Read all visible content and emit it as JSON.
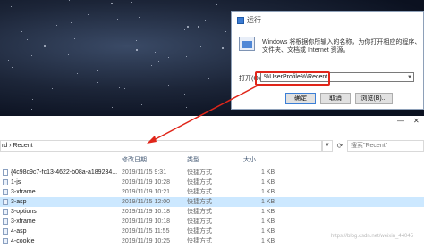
{
  "run_dialog": {
    "title": "运行",
    "description_line1": "Windows 将根据你所输入的名称，为你打开相应的程序、",
    "description_line2": "文件夹、文档或 Internet 资源。",
    "open_label": "打开(O):",
    "input_value": "%UserProfile%\\Recent",
    "buttons": {
      "ok": "确定",
      "cancel": "取消",
      "browse": "浏览(B)..."
    }
  },
  "explorer": {
    "address": "rd › Recent",
    "search_placeholder": "搜索\"Recent\"",
    "columns": {
      "name": "",
      "date": "修改日期",
      "type": "类型",
      "size": "大小"
    },
    "rows": [
      {
        "name": "{4c98c9c7-fc13-4622-b08a-a189234...",
        "date": "2019/11/15 9:31",
        "type": "快捷方式",
        "size": "1 KB"
      },
      {
        "name": "1-js",
        "date": "2019/11/19 10:28",
        "type": "快捷方式",
        "size": "1 KB"
      },
      {
        "name": "3-xframe",
        "date": "2019/11/19 10:21",
        "type": "快捷方式",
        "size": "1 KB"
      },
      {
        "name": "3-asp",
        "date": "2019/11/15 12:00",
        "type": "快捷方式",
        "size": "1 KB"
      },
      {
        "name": "3-options",
        "date": "2019/11/19 10:18",
        "type": "快捷方式",
        "size": "1 KB"
      },
      {
        "name": "3-xframe",
        "date": "2019/11/19 10:18",
        "type": "快捷方式",
        "size": "1 KB"
      },
      {
        "name": "4-asp",
        "date": "2019/11/15 11:55",
        "type": "快捷方式",
        "size": "1 KB"
      },
      {
        "name": "4-cookie",
        "date": "2019/11/19 10:25",
        "type": "快捷方式",
        "size": "1 KB"
      }
    ],
    "selected_row": 3
  },
  "watermark": "https://blog.csdn.net/weixin_44045"
}
